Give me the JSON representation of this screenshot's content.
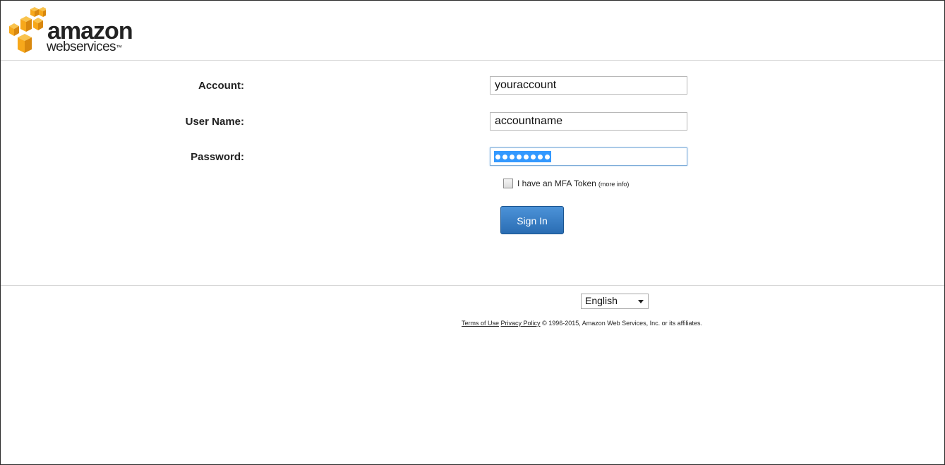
{
  "logo": {
    "brand_line1": "amazon",
    "brand_line2": "webservices",
    "trademark": "™",
    "cube_color": "#f7a81b",
    "cube_dark": "#d9880e"
  },
  "form": {
    "account_label": "Account:",
    "account_value": "youraccount",
    "username_label": "User Name:",
    "username_value": "accountname",
    "password_label": "Password:",
    "password_mask_count": 8,
    "mfa_label": "I have an MFA Token",
    "mfa_more_info": "(more info)",
    "mfa_checked": false,
    "signin_label": "Sign In",
    "signin_color": "#2a6db3"
  },
  "footer": {
    "language_selected": "English",
    "terms_link": "Terms of Use",
    "privacy_link": "Privacy Policy",
    "copyright": "© 1996-2015, Amazon Web Services, Inc. or its affiliates."
  }
}
